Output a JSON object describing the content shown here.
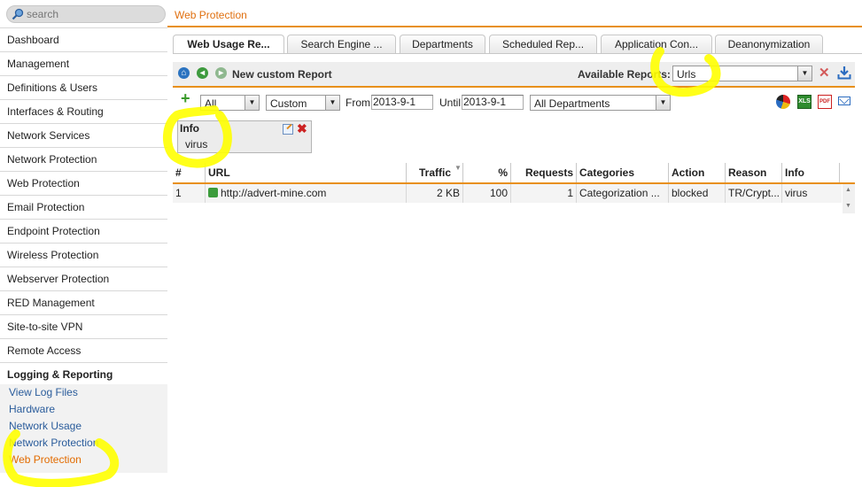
{
  "search": {
    "placeholder": "search"
  },
  "sidebar": {
    "items": [
      {
        "label": "Dashboard"
      },
      {
        "label": "Management"
      },
      {
        "label": "Definitions & Users"
      },
      {
        "label": "Interfaces & Routing"
      },
      {
        "label": "Network Services"
      },
      {
        "label": "Network Protection"
      },
      {
        "label": "Web Protection"
      },
      {
        "label": "Email Protection"
      },
      {
        "label": "Endpoint Protection"
      },
      {
        "label": "Wireless Protection"
      },
      {
        "label": "Webserver Protection"
      },
      {
        "label": "RED Management"
      },
      {
        "label": "Site-to-site VPN"
      },
      {
        "label": "Remote Access"
      },
      {
        "label": "Logging & Reporting"
      }
    ],
    "sub_items": [
      {
        "label": "View Log Files"
      },
      {
        "label": "Hardware"
      },
      {
        "label": "Network Usage"
      },
      {
        "label": "Network Protection"
      },
      {
        "label": "Web Protection",
        "active": true
      }
    ]
  },
  "header": {
    "title": "Web Protection"
  },
  "tabs": [
    {
      "label": "Web Usage Re...",
      "active": true
    },
    {
      "label": "Search Engine ..."
    },
    {
      "label": "Departments"
    },
    {
      "label": "Scheduled Rep..."
    },
    {
      "label": "Application Con..."
    },
    {
      "label": "Deanonymization"
    }
  ],
  "report_bar": {
    "new_report_label": "New custom Report",
    "available_label": "Available Reports:",
    "available_value": "Urls"
  },
  "filters": {
    "scope_value": "All",
    "range_value": "Custom",
    "from_label": "From",
    "from_value": "2013-9-1",
    "until_label": "Until",
    "until_value": "2013-9-1",
    "department_value": "All Departments"
  },
  "info_filter": {
    "title": "Info",
    "value": "virus"
  },
  "table": {
    "headers": [
      "#",
      "URL",
      "Traffic",
      "%",
      "Requests",
      "Categories",
      "Action",
      "Reason",
      "Info"
    ],
    "rows": [
      [
        "1",
        "http://advert-mine.com",
        "2 KB",
        "100",
        "1",
        "Categorization ...",
        "blocked",
        "TR/Crypt...",
        "virus"
      ]
    ]
  },
  "colors": {
    "accent": "#e8901a",
    "link": "#2a5c9b",
    "active_link": "#e26b00",
    "highlighter": "#ffff00"
  },
  "icons": [
    "search-icon",
    "home-icon",
    "back-arrow-icon",
    "forward-arrow-icon",
    "close-icon",
    "download-icon",
    "add-icon",
    "pie-chart-icon",
    "excel-icon",
    "pdf-icon",
    "mail-icon",
    "edit-icon",
    "remove-icon",
    "url-link-icon",
    "sort-arrow-icon"
  ]
}
